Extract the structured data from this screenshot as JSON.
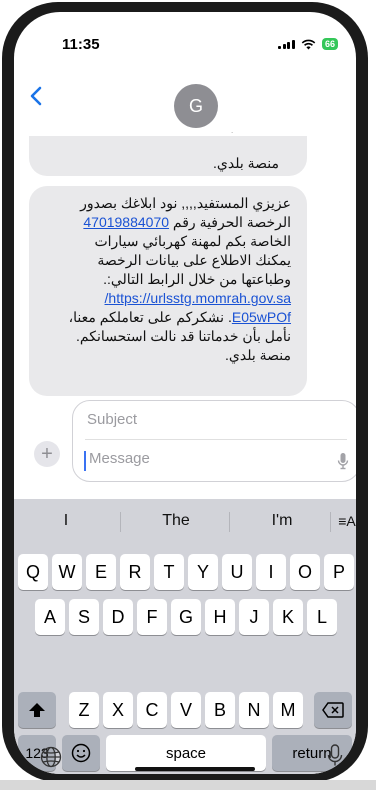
{
  "status_bar": {
    "time": "11:35",
    "battery": "66"
  },
  "header": {
    "avatar_initial": "G",
    "mark": "."
  },
  "messages": {
    "partial_tail": "منصة بلدي.",
    "full": {
      "line1": "عزيزي المستفيد,,,, نود ابلاغك بصدور",
      "line2a": "الرخصة الحرفية رقم ",
      "number": "47019884070",
      "line3": "الخاصة بكم لمهنة كهربائي سيارات",
      "line4": "يمكنك الاطلاع على بيانات الرخصة",
      "line5": "وطباعتها من خلال الرابط التالي:.",
      "link1": "https://urlsstg.momrah.gov.sa/",
      "link2": "E05wPOf",
      "line6b": ". نشكركم على تعاملكم معنا،",
      "line7": "نأمل بأن خدماتنا قد نالت استحسانكم.",
      "line8": "منصة بلدي."
    }
  },
  "compose": {
    "plus": "+",
    "subject_placeholder": "Subject",
    "message_placeholder": "Message"
  },
  "keyboard": {
    "suggestions": [
      "I",
      "The",
      "I'm"
    ],
    "format_key": "≡A",
    "row1": [
      "Q",
      "W",
      "E",
      "R",
      "T",
      "Y",
      "U",
      "I",
      "O",
      "P"
    ],
    "row2": [
      "A",
      "S",
      "D",
      "F",
      "G",
      "H",
      "J",
      "K",
      "L"
    ],
    "row3": [
      "Z",
      "X",
      "C",
      "V",
      "B",
      "N",
      "M"
    ],
    "numbers_key": "123",
    "space_key": "space",
    "return_key": "return"
  },
  "icons": {
    "back": "chevron-left-icon",
    "signal": "signal-icon",
    "wifi": "wifi-icon",
    "battery": "battery-icon",
    "mic": "microphone-icon",
    "emoji": "emoji-icon",
    "globe": "globe-icon",
    "shift": "shift-icon",
    "delete": "delete-icon"
  },
  "colors": {
    "link": "#1a52d4",
    "accent": "#3a72f2",
    "battery": "#34c759",
    "bubble": "#e9e9eb"
  }
}
